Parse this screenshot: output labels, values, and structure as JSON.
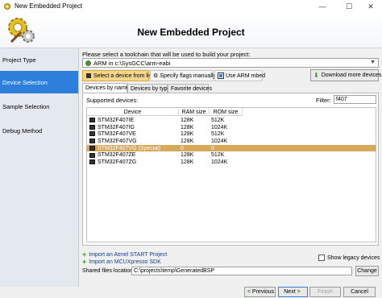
{
  "window": {
    "title": "New Embedded Project",
    "controls": [
      "minimize-icon",
      "maximize-icon",
      "close-icon"
    ]
  },
  "header": {
    "title": "New Embedded Project",
    "logo_icon": "gear-wizard-icon"
  },
  "sidebar": {
    "items": [
      {
        "label": "Project Type",
        "active": false
      },
      {
        "label": "Device Selection",
        "active": true
      },
      {
        "label": "Sample Selection",
        "active": false
      },
      {
        "label": "Debug Method",
        "active": false
      }
    ]
  },
  "toolchain": {
    "prompt": "Please select a toolchain that will be used to build your project:",
    "selected": "ARM in c:\\SysGCC\\arm-eabi"
  },
  "modes": [
    {
      "label": "Select a device from list",
      "active": true,
      "icon": "chip-icon"
    },
    {
      "label": "Specify flags manually",
      "active": false,
      "icon": "wrench-icon"
    },
    {
      "label": "Use ARM mbed",
      "active": false,
      "icon": "mbed-icon"
    }
  ],
  "download_button": "Download more devices",
  "subtabs": [
    {
      "label": "Devices by name",
      "active": true
    },
    {
      "label": "Devices by type",
      "active": false
    },
    {
      "label": "Favorite devices",
      "active": false
    }
  ],
  "devices": {
    "supported_label": "Supported devices:",
    "filter_label": "Filter:",
    "filter_value": "f407",
    "columns": [
      "Device",
      "RAM size",
      "ROM size"
    ],
    "rows": [
      {
        "device": "STM32F407IE",
        "ram": "128K",
        "rom": "512K",
        "selected": false
      },
      {
        "device": "STM32F407IG",
        "ram": "128K",
        "rom": "1024K",
        "selected": false
      },
      {
        "device": "STM32F407VE",
        "ram": "128K",
        "rom": "512K",
        "selected": false
      },
      {
        "device": "STM32F407VG",
        "ram": "128K",
        "rom": "1024K",
        "selected": false
      },
      {
        "device": "STM32F407VG (Special)",
        "ram": "0",
        "rom": "0",
        "selected": true
      },
      {
        "device": "STM32F407ZE",
        "ram": "128K",
        "rom": "512K",
        "selected": false
      },
      {
        "device": "STM32F407ZG",
        "ram": "128K",
        "rom": "1024K",
        "selected": false
      }
    ]
  },
  "imports": [
    "Import an Atmel START Project",
    "Import an MCUXpresso SDK"
  ],
  "legacy_label": "Show legacy devices",
  "shared": {
    "label": "Shared files location:",
    "value": "C:\\projects\\temp\\GeneratedBSP",
    "change": "Change"
  },
  "footer": {
    "previous": "Previous",
    "next": "Next",
    "finish": "Finish",
    "cancel": "Cancel"
  },
  "colors": {
    "accent": "#2d7fdb",
    "selected_row": "#d6a85a",
    "active_mode": "#f5d68a"
  }
}
